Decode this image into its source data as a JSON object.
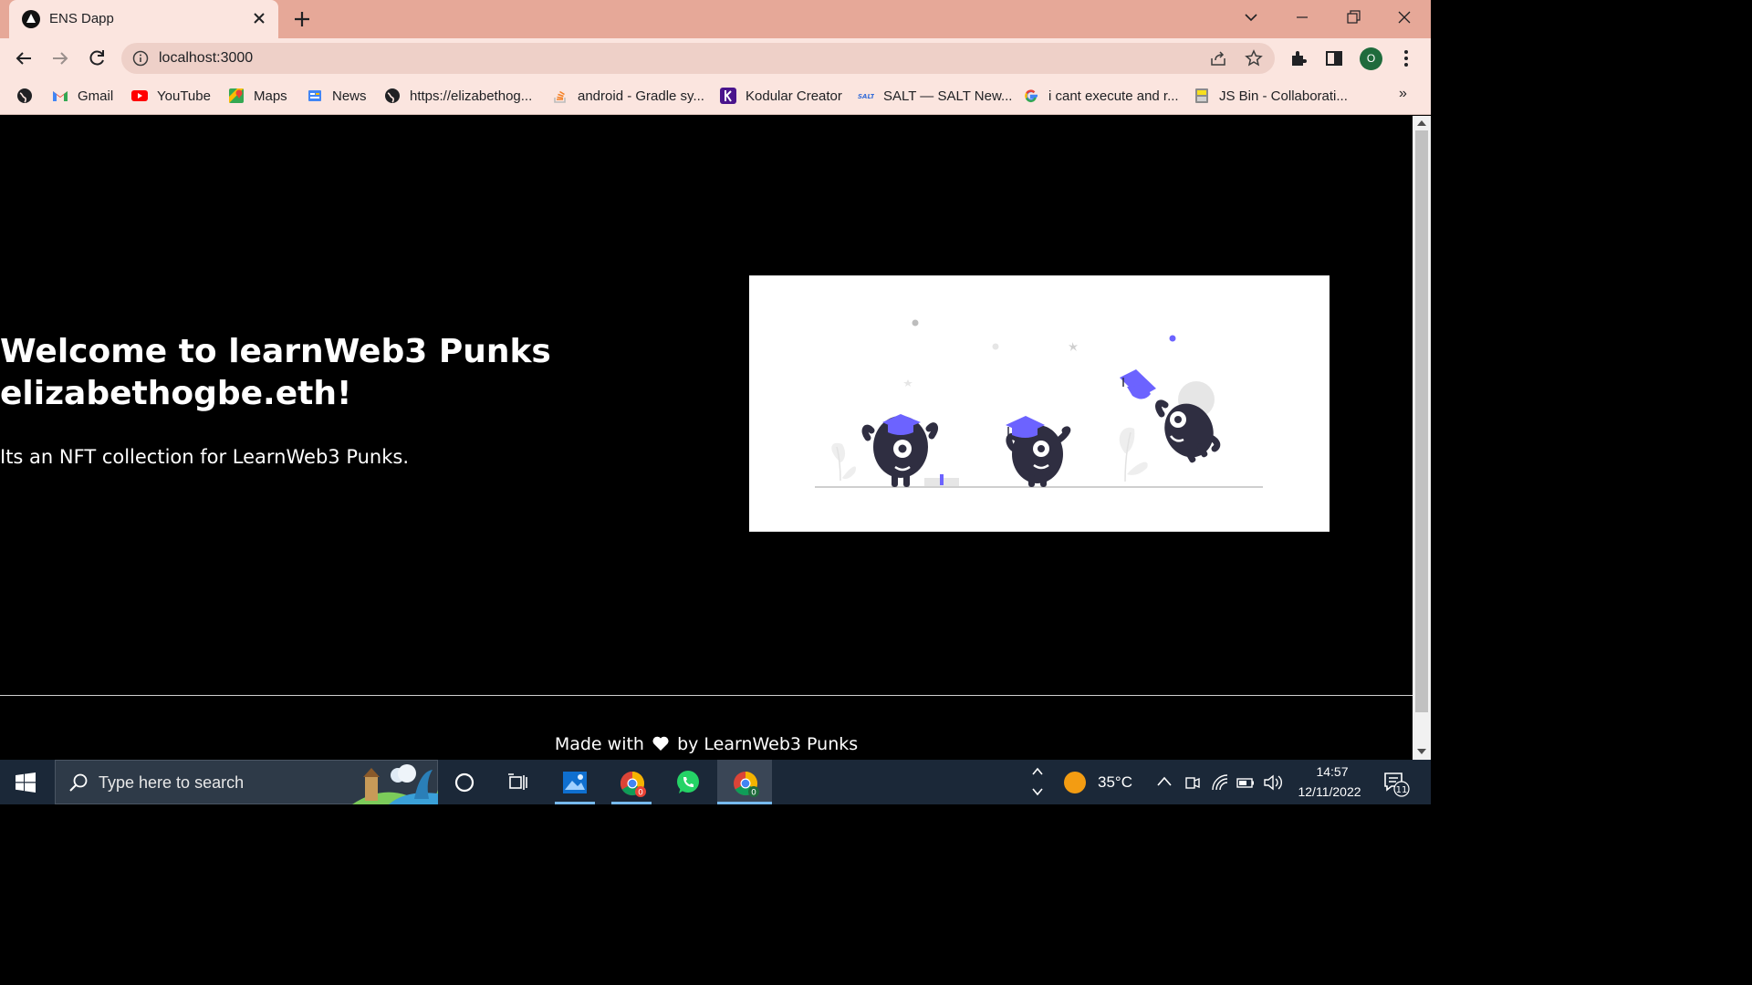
{
  "browser": {
    "tab": {
      "title": "ENS Dapp"
    },
    "address_bar": {
      "url": "localhost:3000"
    },
    "profile_initial": "O",
    "bookmarks": [
      {
        "label": "",
        "icon": "globe-icon"
      },
      {
        "label": "Gmail",
        "icon": "gmail-icon"
      },
      {
        "label": "YouTube",
        "icon": "youtube-icon"
      },
      {
        "label": "Maps",
        "icon": "maps-icon"
      },
      {
        "label": "News",
        "icon": "news-icon"
      },
      {
        "label": "https://elizabethog...",
        "icon": "globe-icon"
      },
      {
        "label": "android - Gradle sy...",
        "icon": "stackoverflow-icon"
      },
      {
        "label": "Kodular Creator",
        "icon": "kodular-icon"
      },
      {
        "label": "SALT — SALT New...",
        "icon": "salt-icon"
      },
      {
        "label": "i cant execute and r...",
        "icon": "google-icon"
      },
      {
        "label": "JS Bin - Collaborati...",
        "icon": "jsbin-icon"
      }
    ],
    "bookmarks_more": "»"
  },
  "page": {
    "title_line1": "Welcome to learnWeb3 Punks",
    "title_line2": "elizabethogbe.eth!",
    "description": "Its an NFT collection for LearnWeb3 Punks.",
    "footer": {
      "before": "Made with",
      "after": "by LearnWeb3 Punks",
      "heart_icon": "heart-icon"
    }
  },
  "taskbar": {
    "search_placeholder": "Type here to search",
    "weather": "35°C",
    "time": "14:57",
    "date": "12/11/2022",
    "notifications": "11",
    "chrome_badge": "0"
  },
  "colors": {
    "tab_strip": "#e6a898",
    "toolbar": "#fbe5df",
    "page_bg": "#000000",
    "illustration_accent": "#6c63ff",
    "taskbar": "#1b2838"
  }
}
